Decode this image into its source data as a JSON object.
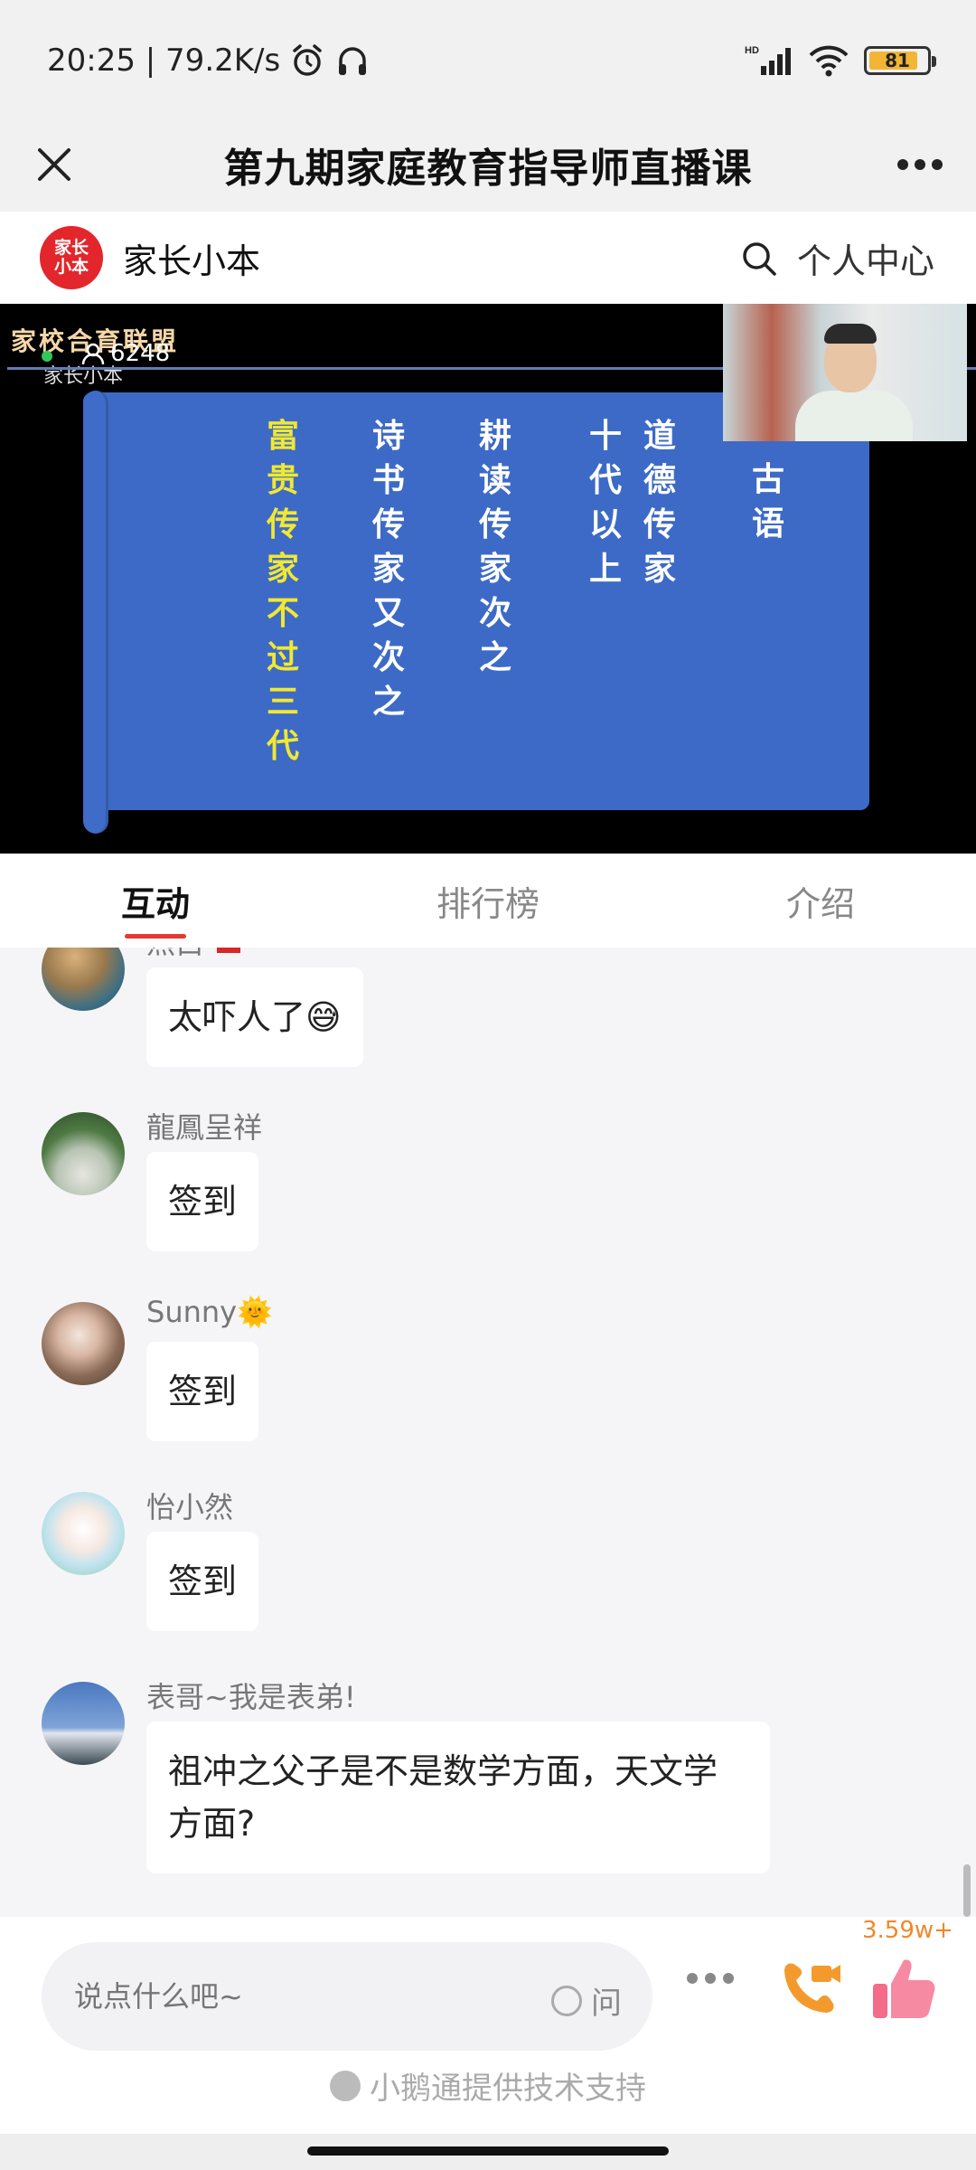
{
  "status_bar": {
    "time_speed": "20:25 | 79.2K/s",
    "signal_label": "HD",
    "battery": "81"
  },
  "title_bar": {
    "title": "第九期家庭教育指导师直播课"
  },
  "brand": {
    "logo_text_1": "家长",
    "logo_text_2": "小本",
    "name": "家长小本",
    "personal_center": "个人中心"
  },
  "video": {
    "brand": "家校合育联盟",
    "brand_sub": "家长小本",
    "viewers": "6248",
    "slide_columns": [
      {
        "chars": [
          "富",
          "贵",
          "传",
          "家",
          "不",
          "过",
          "三",
          "代"
        ],
        "color": "#f0e832"
      },
      {
        "chars": [
          "诗",
          "书",
          "传",
          "家",
          "又",
          "次",
          "之"
        ],
        "color": "#ffffff"
      },
      {
        "chars": [
          "耕",
          "读",
          "传",
          "家",
          "次",
          "之"
        ],
        "color": "#ffffff"
      },
      {
        "chars": [
          "十",
          "代",
          "以",
          "上"
        ],
        "color": "#ffffff"
      },
      {
        "chars": [
          "道",
          "德",
          "传",
          "家"
        ],
        "color": "#ffffff"
      },
      {
        "chars": [
          "古",
          "语"
        ],
        "color": "#ffffff"
      }
    ]
  },
  "tabs": [
    {
      "label": "互动",
      "active": true
    },
    {
      "label": "排行榜",
      "active": false
    },
    {
      "label": "介绍",
      "active": false
    }
  ],
  "messages": [
    {
      "name": "燕白",
      "text": "太吓人了😅"
    },
    {
      "name": "龍鳳呈祥",
      "text": "签到"
    },
    {
      "name": "Sunny🌞",
      "text": "签到"
    },
    {
      "name": "怡小然",
      "text": "签到"
    },
    {
      "name": "表哥~我是表弟!",
      "text_line1": "祖冲之父子是不是数学方面，天文学",
      "text_line2": "方面?"
    }
  ],
  "bottom": {
    "input_placeholder": "说点什么吧~",
    "ask_label": "问",
    "like_count": "3.59w+",
    "footer_note": "小鹅通提供技术支持"
  }
}
